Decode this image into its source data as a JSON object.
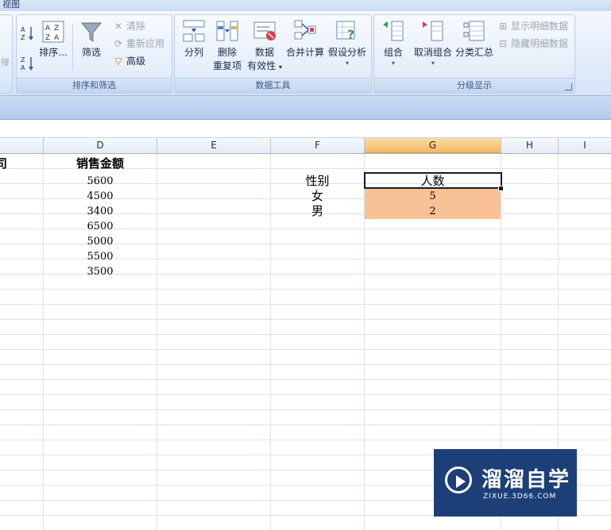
{
  "ribbon_tab": {
    "label": "视图"
  },
  "ribbon": {
    "sort_filter": {
      "group_label": "排序和筛选",
      "left_partial_label": "接",
      "sort_az_icon": "sort-az-icon",
      "sort_za_icon": "sort-za-icon",
      "sort_label": "排序...",
      "filter_label": "筛选",
      "clear_label": "清除",
      "reapply_label": "重新应用",
      "advanced_label": "高级"
    },
    "data_tools": {
      "group_label": "数据工具",
      "split_label": "分列",
      "remove_dup_label_1": "删除",
      "remove_dup_label_2": "重复项",
      "validation_label_1": "数据",
      "validation_label_2": "有效性",
      "consolidate_label": "合并计算",
      "whatif_label": "假设分析"
    },
    "outline": {
      "group_label": "分级显示",
      "group_btn_label": "组合",
      "ungroup_label": "取消组合",
      "subtotal_label": "分类汇总",
      "show_detail_label": "显示明细数据",
      "hide_detail_label": "隐藏明细数据"
    }
  },
  "grid": {
    "columns": [
      "D",
      "E",
      "F",
      "G",
      "H",
      "I"
    ],
    "active_column": "G",
    "partial_left_header": "司",
    "sales_header": "销售金额",
    "sales_values": [
      "5600",
      "4500",
      "3400",
      "6500",
      "5000",
      "5500",
      "3500"
    ],
    "summary": {
      "col1_header": "性别",
      "col2_header": "人数",
      "rows": [
        {
          "gender": "女",
          "count": "5"
        },
        {
          "gender": "男",
          "count": "2"
        }
      ]
    },
    "highlight_color": "#f9c296"
  },
  "watermark": {
    "title": "溜溜自学",
    "url": "ZIXUE.3D66.COM",
    "bg_color": "#1d3f78"
  }
}
